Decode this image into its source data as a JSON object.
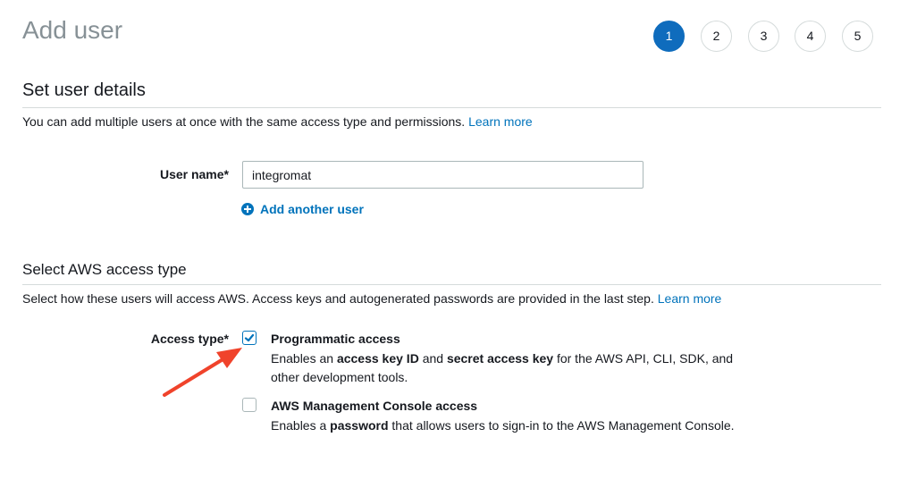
{
  "page": {
    "title": "Add user"
  },
  "steps": [
    {
      "label": "1",
      "active": true
    },
    {
      "label": "2",
      "active": false
    },
    {
      "label": "3",
      "active": false
    },
    {
      "label": "4",
      "active": false
    },
    {
      "label": "5",
      "active": false
    }
  ],
  "user_details": {
    "heading": "Set user details",
    "description": "You can add multiple users at once with the same access type and permissions.",
    "learn_more": "Learn more",
    "user_name_label": "User name*",
    "user_name_value": "integromat",
    "add_another_user": "Add another user",
    "add_icon": "plus-circle-icon"
  },
  "access_type": {
    "heading": "Select AWS access type",
    "description": "Select how these users will access AWS. Access keys and autogenerated passwords are provided in the last step.",
    "learn_more": "Learn more",
    "label": "Access type*",
    "options": [
      {
        "title": "Programmatic access",
        "checked": true,
        "desc_parts": [
          {
            "text": "Enables an ",
            "bold": false
          },
          {
            "text": "access key ID",
            "bold": true
          },
          {
            "text": " and ",
            "bold": false
          },
          {
            "text": "secret access key",
            "bold": true
          },
          {
            "text": " for the AWS API, CLI, SDK, and other development tools.",
            "bold": false
          }
        ]
      },
      {
        "title": "AWS Management Console access",
        "checked": false,
        "desc_parts": [
          {
            "text": "Enables a ",
            "bold": false
          },
          {
            "text": "password",
            "bold": true
          },
          {
            "text": " that allows users to sign-in to the AWS Management Console.",
            "bold": false
          }
        ]
      }
    ]
  },
  "annotation": {
    "arrow_color": "#f0432b",
    "arrow_icon": "red-arrow-icon"
  },
  "colors": {
    "accent": "#0f6cbd",
    "link": "#0073bb",
    "title_gray": "#879196"
  }
}
